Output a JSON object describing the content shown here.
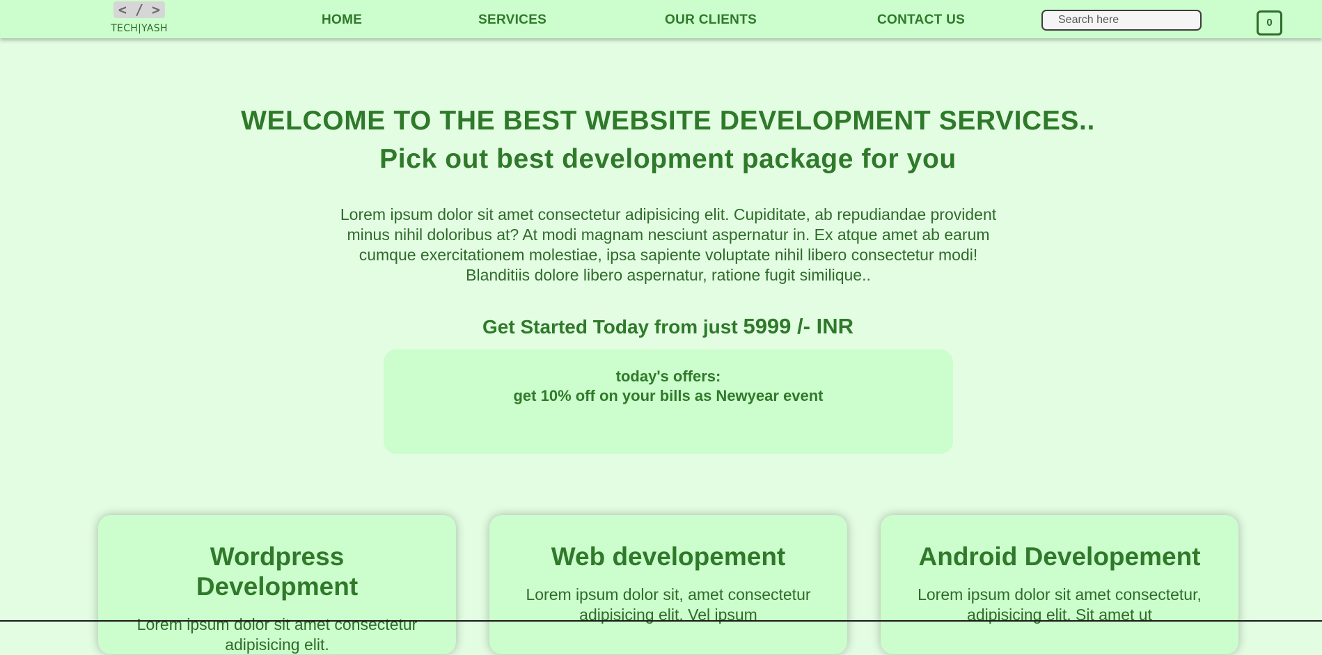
{
  "navbar": {
    "logo_mark": "< / >",
    "logo_text": "TECH|YASH",
    "links": [
      "HOME",
      "SERVICES",
      "OUR CLIENTS",
      "CONTACT US"
    ],
    "search_placeholder": "Search here",
    "cart_count": "0"
  },
  "hero": {
    "title": "WELCOME TO THE BEST WEBSITE DEVELOPMENT SERVICES..",
    "subtitle": "Pick out best development package for you",
    "intro": "Lorem ipsum dolor sit amet consectetur adipisicing elit. Cupiditate, ab repudiandae provident minus nihil doloribus at? At modi magnam nesciunt aspernatur in. Ex atque amet ab earum cumque exercitationem molestiae, ipsa sapiente voluptate nihil libero consectetur modi! Blanditiis dolore libero aspernatur, ratione fugit similique..",
    "cta_prefix": "Get Started Today from just ",
    "cta_price": "5999 /- INR"
  },
  "offers": {
    "heading": "today's offers:",
    "text": "get 10% off on your bills as Newyear event"
  },
  "cards": [
    {
      "title": "Wordpress Development",
      "text": "Lorem ipsum dolor sit amet consectetur adipisicing elit."
    },
    {
      "title": "Web developement",
      "text": "Lorem ipsum dolor sit, amet consectetur adipisicing elit. Vel ipsum"
    },
    {
      "title": "Android Developement",
      "text": "Lorem ipsum dolor sit amet consectetur, adipisicing elit. Sit amet ut"
    }
  ],
  "colors": {
    "page_background": "#e3fde3",
    "panel_background": "#ccfdcc",
    "text_green": "#2f7a2a"
  }
}
